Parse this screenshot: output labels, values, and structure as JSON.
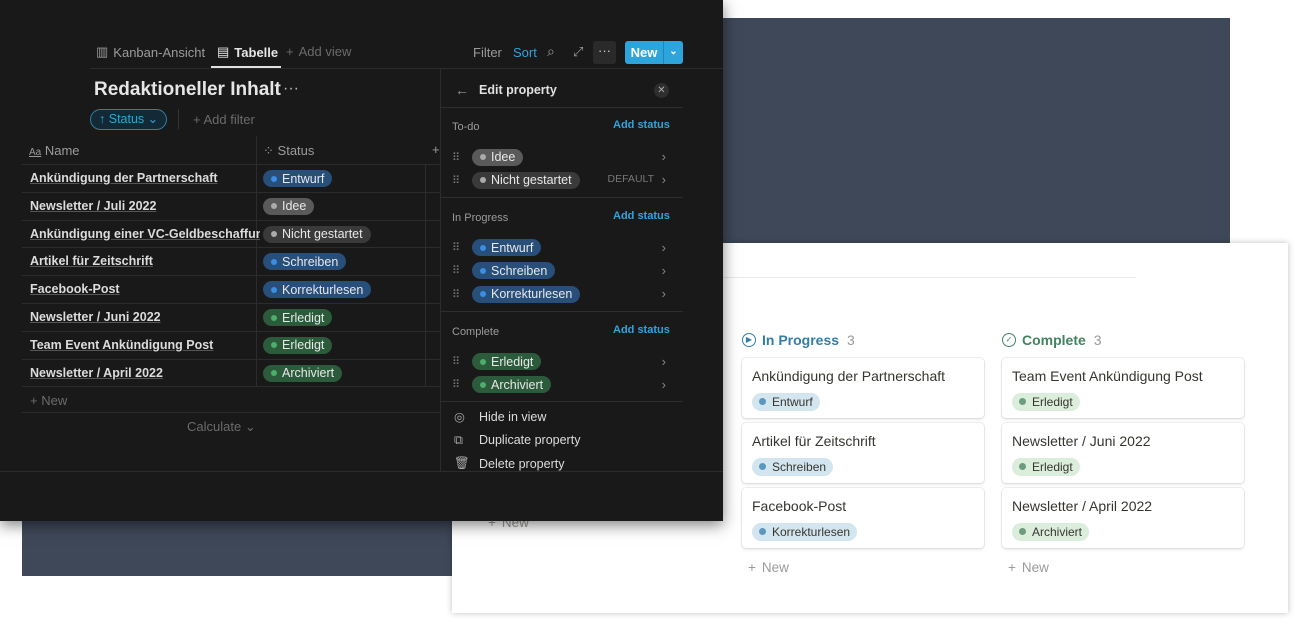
{
  "tabs": [
    {
      "label": "Kanban-Ansicht",
      "icon": "board-icon"
    },
    {
      "label": "Tabelle",
      "icon": "table-icon",
      "active": true
    }
  ],
  "add_view": "Add view",
  "toolbar": {
    "filter": "Filter",
    "sort": "Sort",
    "new": "New"
  },
  "title": "Redaktioneller Inhalt",
  "sort_chip": "Status",
  "add_filter": "Add filter",
  "columns": {
    "name": "Name",
    "status": "Status"
  },
  "rows": [
    {
      "name": "Ankündigung der Partnerschaft",
      "status": "Entwurf",
      "color": "blue"
    },
    {
      "name": "Newsletter / Juli 2022",
      "status": "Idee",
      "color": "gray"
    },
    {
      "name": "Ankündigung einer VC-Geldbeschaffung",
      "status": "Nicht gestartet",
      "color": "dgray"
    },
    {
      "name": "Artikel für Zeitschrift",
      "status": "Schreiben",
      "color": "blue"
    },
    {
      "name": "Facebook-Post",
      "status": "Korrekturlesen",
      "color": "blue"
    },
    {
      "name": "Newsletter / Juni 2022",
      "status": "Erledigt",
      "color": "green"
    },
    {
      "name": "Team Event Ankündigung Post",
      "status": "Erledigt",
      "color": "green"
    },
    {
      "name": "Newsletter / April 2022",
      "status": "Archiviert",
      "color": "green"
    }
  ],
  "table_new": "New",
  "calculate": "Calculate",
  "panel": {
    "title": "Edit property",
    "add_status": "Add status",
    "default": "DEFAULT",
    "groups": [
      {
        "name": "To-do",
        "options": [
          "Idee",
          "Nicht gestartet"
        ]
      },
      {
        "name": "In Progress",
        "options": [
          "Entwurf",
          "Schreiben",
          "Korrekturlesen"
        ]
      },
      {
        "name": "Complete",
        "options": [
          "Erledigt",
          "Archiviert"
        ]
      }
    ],
    "actions": [
      "Hide in view",
      "Duplicate property",
      "Delete property"
    ]
  },
  "board": {
    "columns": [
      {
        "name": "In Progress",
        "count": "3",
        "color": "#337ea9",
        "cards": [
          {
            "title": "Ankündigung der Partnerschaft",
            "status": "Entwurf"
          },
          {
            "title": "Artikel für Zeitschrift",
            "status": "Schreiben"
          },
          {
            "title": "Facebook-Post",
            "status": "Korrekturlesen"
          }
        ]
      },
      {
        "name": "Complete",
        "count": "3",
        "color": "#448361",
        "cards": [
          {
            "title": "Team Event Ankündigung Post",
            "status": "Erledigt"
          },
          {
            "title": "Newsletter / Juni 2022",
            "status": "Erledigt"
          },
          {
            "title": "Newsletter / April 2022",
            "status": "Archiviert"
          }
        ]
      }
    ],
    "new": "New"
  },
  "colors": {
    "accent": "#2ea4dd",
    "blue_pill": "#284e7a",
    "gray_pill": "#5a5a5a",
    "dgray_pill": "#3a3a3a",
    "green_pill": "#2b5b3a"
  }
}
